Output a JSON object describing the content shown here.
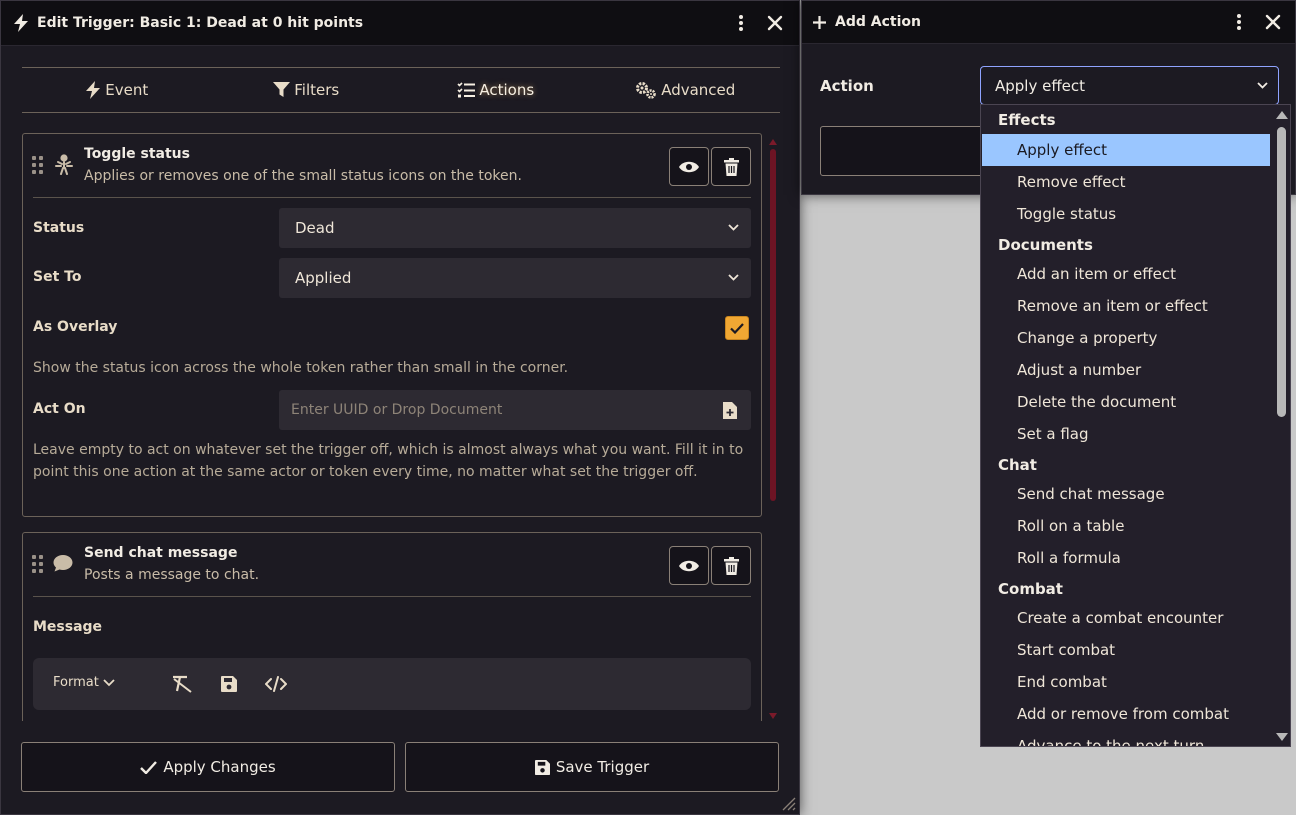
{
  "trigger_window": {
    "title": "Edit Trigger: Basic 1: Dead at 0 hit points",
    "tabs": [
      {
        "label": "Event",
        "icon": "bolt-icon"
      },
      {
        "label": "Filters",
        "icon": "funnel-icon"
      },
      {
        "label": "Actions",
        "icon": "list-check-icon",
        "active": true
      },
      {
        "label": "Advanced",
        "icon": "gears-icon"
      }
    ],
    "actions": [
      {
        "title": "Toggle status",
        "description": "Applies or removes one of the small status icons on the token.",
        "icon": "person-status-icon",
        "fields": {
          "status_label": "Status",
          "status_value": "Dead",
          "set_to_label": "Set To",
          "set_to_value": "Applied",
          "as_overlay_label": "As Overlay",
          "as_overlay_checked": true,
          "as_overlay_hint": "Show the status icon across the whole token rather than small in the corner.",
          "act_on_label": "Act On",
          "act_on_placeholder": "Enter UUID or Drop Document",
          "act_on_value": "",
          "act_on_hint": "Leave empty to act on whatever set the trigger off, which is almost always what you want. Fill it in to point this one action at the same actor or token every time, no matter what set the trigger off."
        }
      },
      {
        "title": "Send chat message",
        "description": "Posts a message to chat.",
        "icon": "speech-bubble-icon",
        "fields": {
          "message_label": "Message",
          "format_label": "Format"
        }
      }
    ],
    "footer": {
      "apply_label": "Apply Changes",
      "save_label": "Save Trigger"
    }
  },
  "add_action_window": {
    "title": "Add Action",
    "action_label": "Action",
    "selected_action": "Apply effect",
    "options": [
      {
        "group": "Effects",
        "items": [
          "Apply effect",
          "Remove effect",
          "Toggle status"
        ]
      },
      {
        "group": "Documents",
        "items": [
          "Add an item or effect",
          "Remove an item or effect",
          "Change a property",
          "Adjust a number",
          "Delete the document",
          "Set a flag"
        ]
      },
      {
        "group": "Chat",
        "items": [
          "Send chat message",
          "Roll on a table",
          "Roll a formula"
        ]
      },
      {
        "group": "Combat",
        "items": [
          "Create a combat encounter",
          "Start combat",
          "End combat",
          "Add or remove from combat",
          "Advance to the next turn"
        ]
      }
    ]
  },
  "colors": {
    "window_bg": "#1c1a22",
    "header_bg": "#0f0e12",
    "accent_checkbox": "#f0a733",
    "scrollbar": "#6d1424",
    "selected_option": "#9ac6ff",
    "text": "#e8dcc8"
  }
}
